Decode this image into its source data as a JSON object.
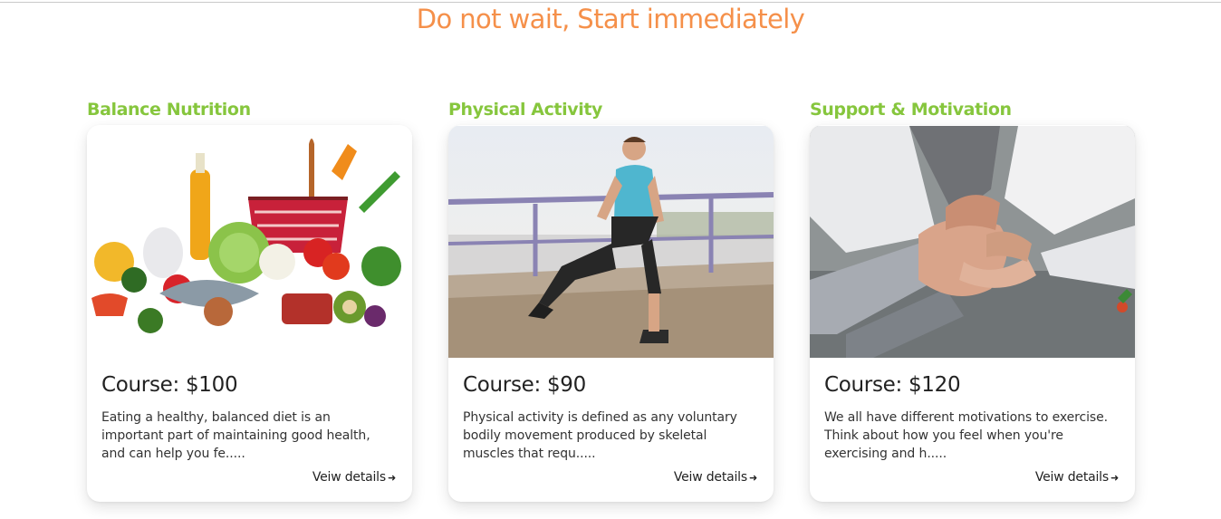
{
  "headline": "Do not wait, Start immediately",
  "cards": [
    {
      "title": "Balance Nutrition",
      "image": "vegetables-fruits-image",
      "price": "Course: $100",
      "description": "Eating a healthy, balanced diet is an important part of maintaining good health, and can help you fe.....",
      "link": "Veiw details",
      "link_icon": "arrow-right-icon"
    },
    {
      "title": "Physical Activity",
      "image": "man-stretching-image",
      "price": "Course: $90",
      "description": "Physical activity is defined as any voluntary bodily movement produced by skeletal muscles that requ.....",
      "link": "Veiw details",
      "link_icon": "arrow-right-icon"
    },
    {
      "title": "Support & Motivation",
      "image": "team-hands-together-image",
      "price": "Course: $120",
      "description": "We all have different motivations to exercise. Think about how you feel when you're exercising and h.....",
      "link": "Veiw details",
      "link_icon": "arrow-right-icon"
    }
  ],
  "colors": {
    "headline": "#f5904a",
    "title": "#86c63d"
  }
}
